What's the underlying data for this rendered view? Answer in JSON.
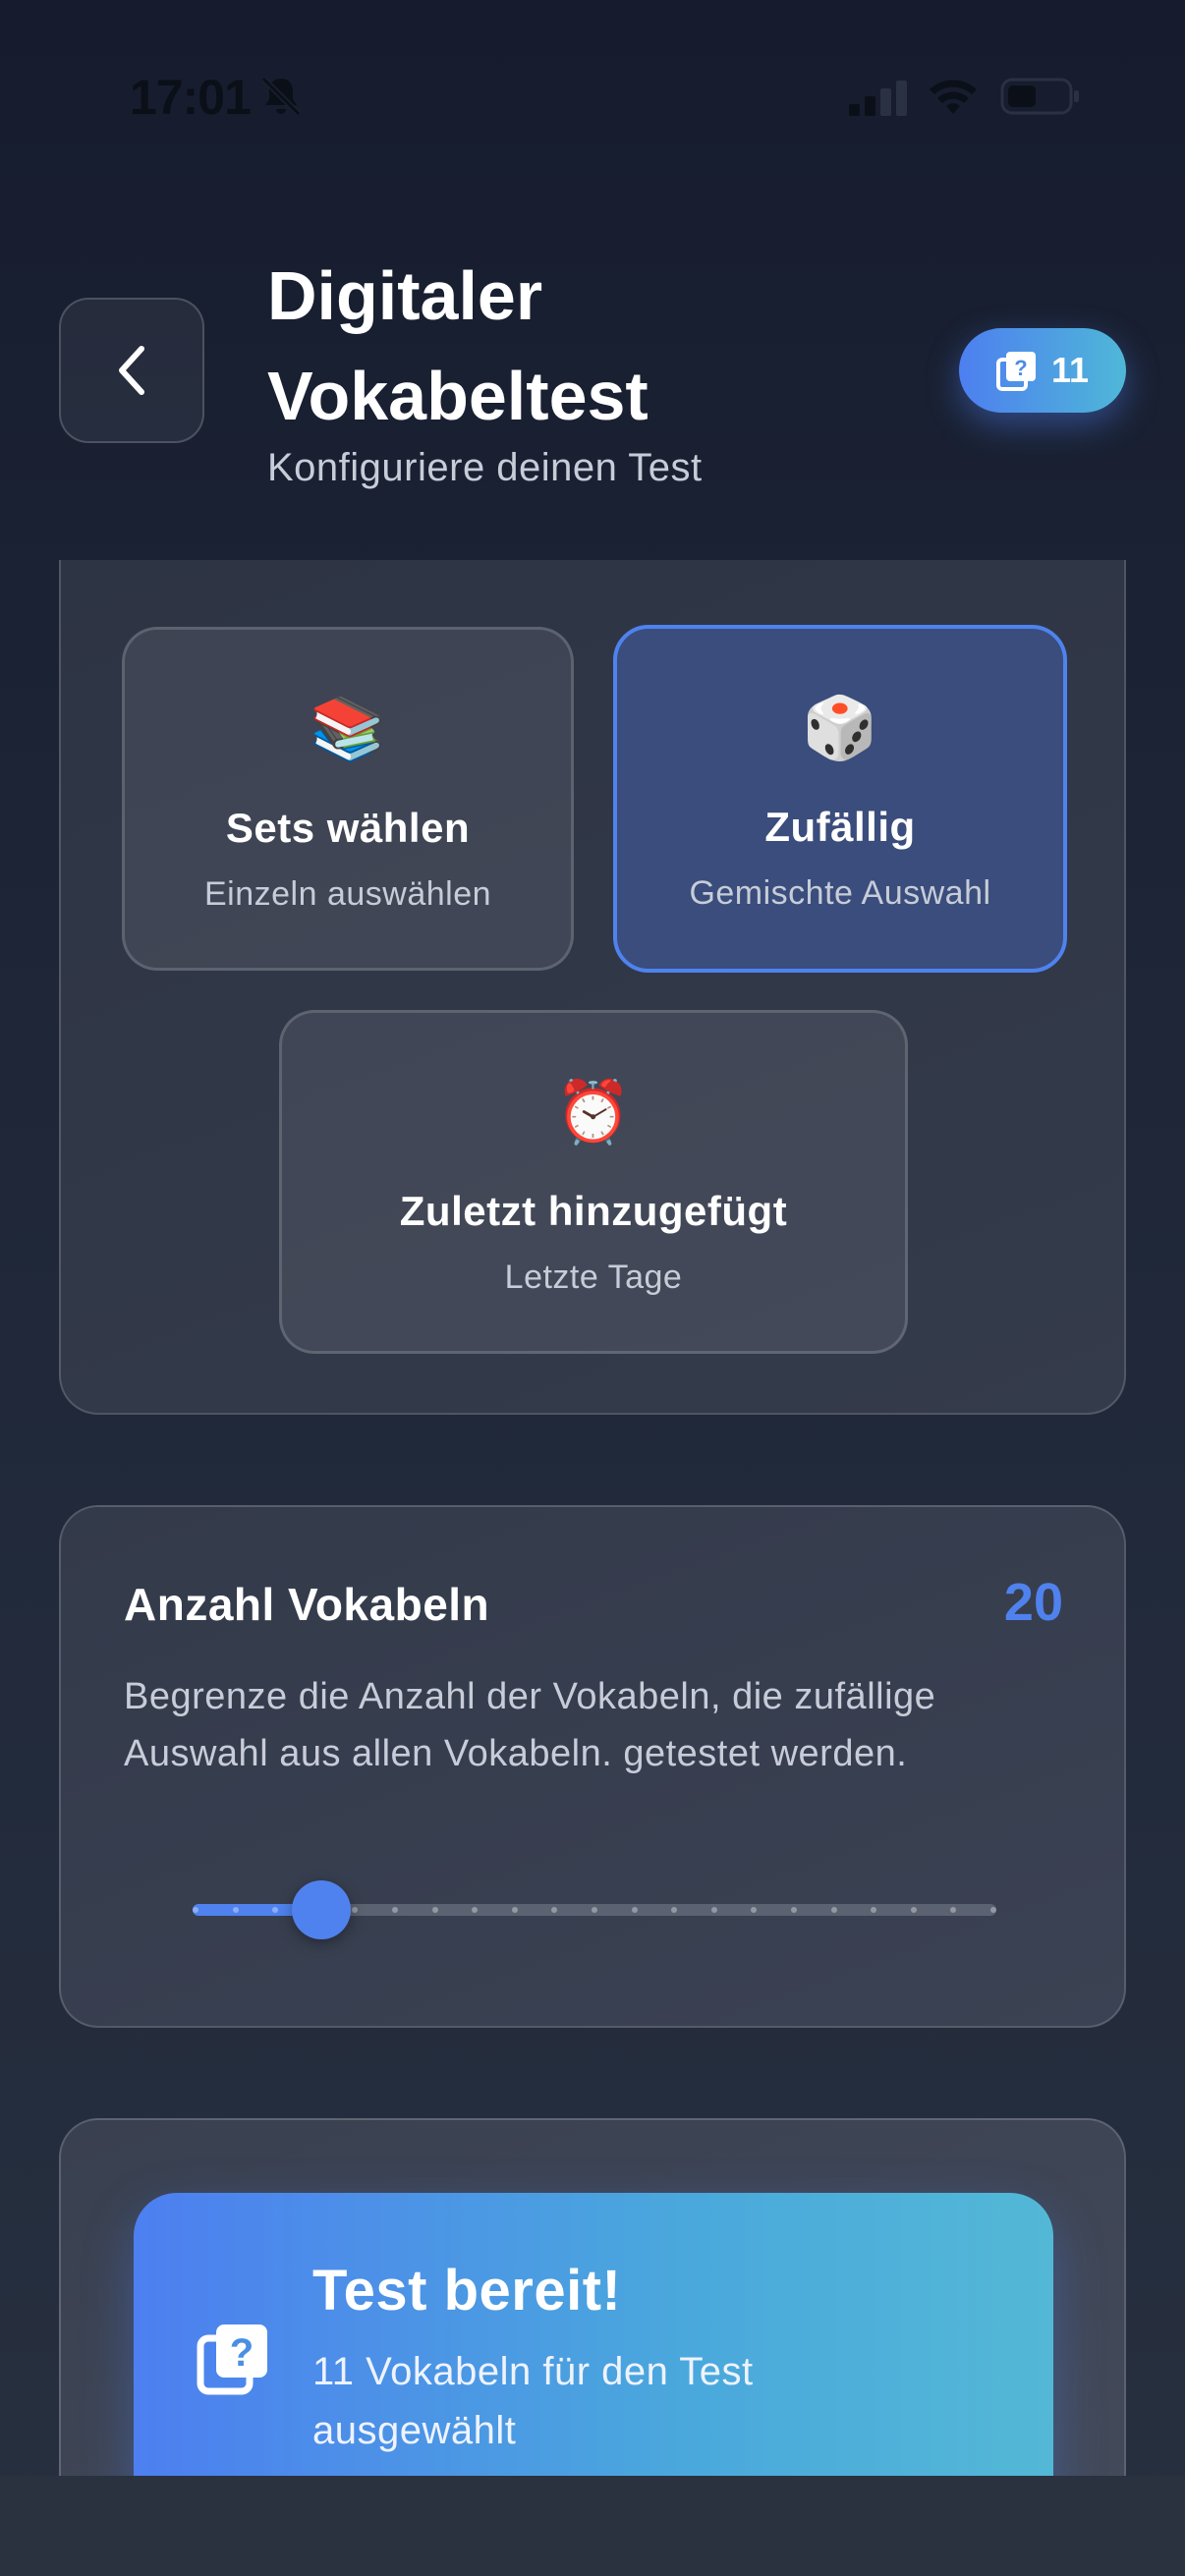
{
  "status_bar": {
    "time": "17:01"
  },
  "header": {
    "title": "Digitaler Vokabeltest",
    "subtitle": "Konfiguriere deinen Test",
    "badge_count": "11"
  },
  "selection": {
    "options": [
      {
        "emoji": "📚",
        "title": "Sets wählen",
        "subtitle": "Einzeln auswählen",
        "selected": false
      },
      {
        "emoji": "🎲",
        "title": "Zufällig",
        "subtitle": "Gemischte Auswahl",
        "selected": true
      },
      {
        "emoji": "⏰",
        "title": "Zuletzt hinzugefügt",
        "subtitle": "Letzte Tage",
        "selected": false
      }
    ]
  },
  "amount": {
    "title": "Anzahl Vokabeln",
    "value": "20",
    "description": "Begrenze die Anzahl der Vokabeln, die zufällige Auswahl aus allen Vokabeln. getestet werden.",
    "slider_fraction": 0.16
  },
  "ready": {
    "title": "Test bereit!",
    "subtitle": "11 Vokabeln für den Test ausgewählt"
  },
  "colors": {
    "accent": "#4f82ee",
    "badge_gradient_start": "#4d7ff0",
    "badge_gradient_end": "#4fb7d8"
  },
  "icons": {
    "back": "chevron-left-icon",
    "badge": "quiz-cards-icon",
    "ready": "quiz-cards-icon",
    "bell": "bell-slash-icon"
  }
}
